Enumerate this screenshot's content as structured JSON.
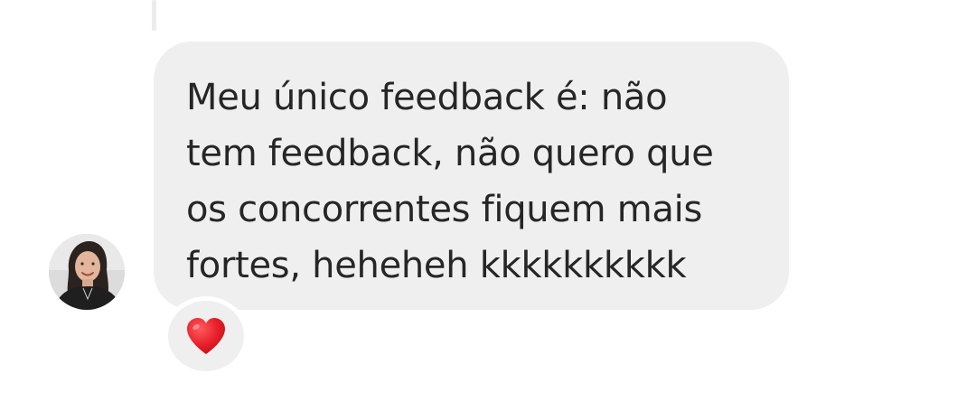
{
  "message": {
    "lines": [
      "Meu único feedback é: não",
      "tem feedback, não quero que",
      "os concorrentes fiquem mais",
      "fortes, heheheh kkkkkkkkkk"
    ]
  },
  "reaction": {
    "icon": "heart-icon",
    "color": "#e8202a"
  },
  "colors": {
    "bubble": "#efefef",
    "text": "#262626",
    "background": "#ffffff"
  }
}
